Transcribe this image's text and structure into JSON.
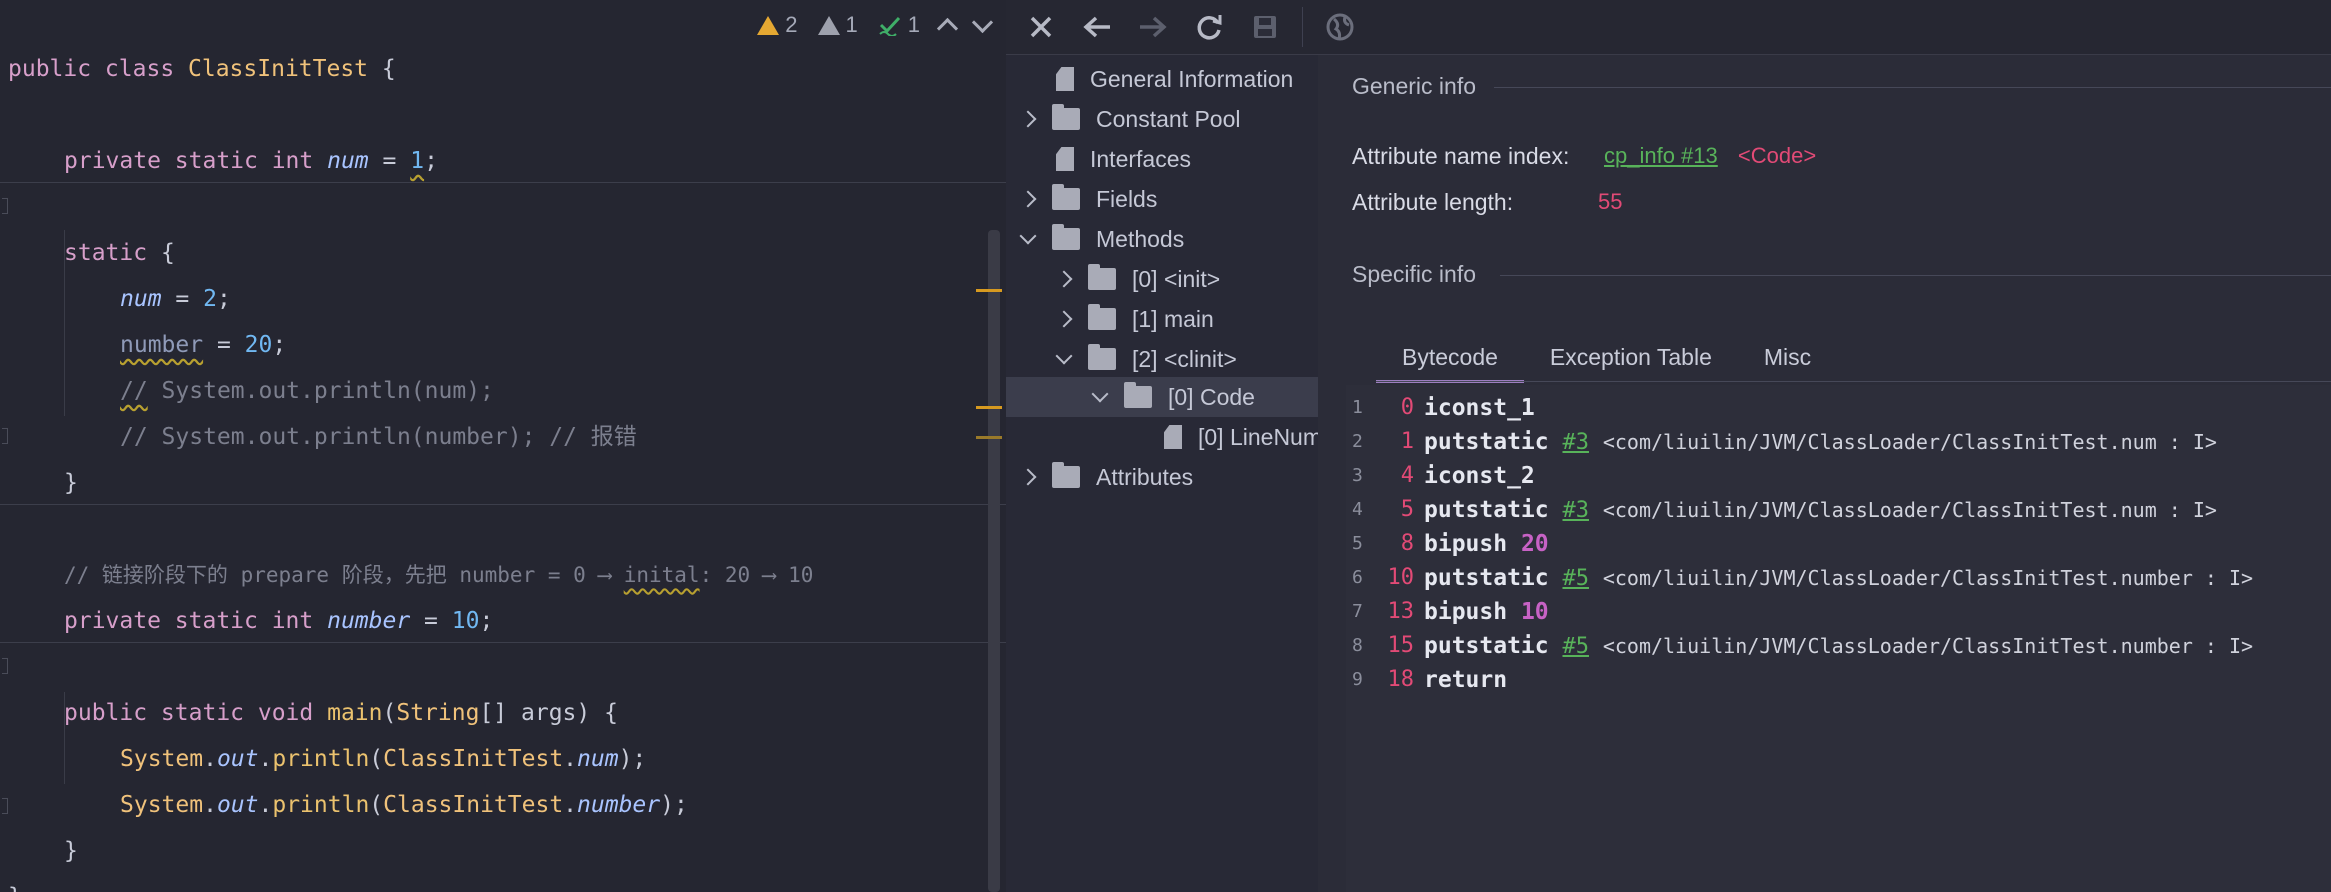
{
  "editor": {
    "inspections": {
      "warnings": "2",
      "weak_warnings": "1",
      "typos": "1"
    },
    "line1": {
      "kw": "public class ",
      "cls": "ClassInitTest",
      "rest": " {"
    },
    "line2": {
      "kw": "private static int ",
      "var": "num",
      "eq": " = ",
      "num": "1",
      "semi": ";"
    },
    "line3": {
      "kw": "static",
      "rest": " {"
    },
    "line4": {
      "var": "num",
      "eq": " = ",
      "num": "2",
      "semi": ";"
    },
    "line5": {
      "var": "number",
      "eq": " = ",
      "num": "20",
      "semi": ";"
    },
    "line6": {
      "cmt1": "//",
      "cmt2": " System.out.println(num);"
    },
    "line7": {
      "cmt": "// System.out.println(number); // 报错"
    },
    "line8": {
      "close": "}"
    },
    "line9": {
      "cmt1": "// 链接阶段下的 prepare 阶段，先把 number = 0 ⟶ ",
      "cmt2": "inital",
      "cmt3": ": 20 ⟶ 10"
    },
    "line10": {
      "kw": "private static int ",
      "var": "number",
      "eq": " = ",
      "num": "10",
      "semi": ";"
    },
    "line11": {
      "kw": "public static void ",
      "fn": "main",
      "p1": "(",
      "cls": "String",
      "p2": "[] args) {"
    },
    "line12": {
      "cls": "System",
      "dot1": ".",
      "out": "out",
      "dot2": ".",
      "fn": "println",
      "p1": "(",
      "cls2": "ClassInitTest",
      "dot3": ".",
      "var": "num",
      "p2": ");"
    },
    "line13": {
      "cls": "System",
      "dot1": ".",
      "out": "out",
      "dot2": ".",
      "fn": "println",
      "p1": "(",
      "cls2": "ClassInitTest",
      "dot3": ".",
      "var": "number",
      "p2": ");"
    },
    "line14": {
      "close": "}"
    },
    "line15": {
      "close": "}"
    }
  },
  "toolbar": {
    "icons": [
      "close-icon",
      "back-arrow-icon",
      "forward-arrow-icon",
      "refresh-icon",
      "save-icon",
      "globe-icon"
    ]
  },
  "tree": {
    "general": "General Information",
    "constant_pool": "Constant Pool",
    "interfaces": "Interfaces",
    "fields": "Fields",
    "methods": "Methods",
    "m0": "[0] <init>",
    "m1": "[1] main",
    "m2": "[2] <clinit>",
    "code": "[0] Code",
    "linenum": "[0] LineNum",
    "attributes": "Attributes"
  },
  "details": {
    "generic_title": "Generic info",
    "name_index_label": "Attribute name index:",
    "name_index_link": "cp_info #13",
    "name_index_value": "<Code>",
    "length_label": "Attribute length:",
    "length_value": "55",
    "specific_title": "Specific info",
    "tabs": [
      "Bytecode",
      "Exception Table",
      "Misc"
    ],
    "active_tab": "Bytecode"
  },
  "bytecode": [
    {
      "ln": "1",
      "off": "0",
      "op": "iconst_1",
      "ref": "",
      "desc": "",
      "push": ""
    },
    {
      "ln": "2",
      "off": "1",
      "op": "putstatic",
      "ref": "#3",
      "desc": "<com/liuilin/JVM/ClassLoader/ClassInitTest.num : I>",
      "push": ""
    },
    {
      "ln": "3",
      "off": "4",
      "op": "iconst_2",
      "ref": "",
      "desc": "",
      "push": ""
    },
    {
      "ln": "4",
      "off": "5",
      "op": "putstatic",
      "ref": "#3",
      "desc": "<com/liuilin/JVM/ClassLoader/ClassInitTest.num : I>",
      "push": ""
    },
    {
      "ln": "5",
      "off": "8",
      "op": "bipush",
      "ref": "",
      "desc": "",
      "push": "20"
    },
    {
      "ln": "6",
      "off": "10",
      "op": "putstatic",
      "ref": "#5",
      "desc": "<com/liuilin/JVM/ClassLoader/ClassInitTest.number : I>",
      "push": ""
    },
    {
      "ln": "7",
      "off": "13",
      "op": "bipush",
      "ref": "",
      "desc": "",
      "push": "10"
    },
    {
      "ln": "8",
      "off": "15",
      "op": "putstatic",
      "ref": "#5",
      "desc": "<com/liuilin/JVM/ClassLoader/ClassInitTest.number : I>",
      "push": ""
    },
    {
      "ln": "9",
      "off": "18",
      "op": "return",
      "ref": "",
      "desc": "",
      "push": ""
    }
  ]
}
